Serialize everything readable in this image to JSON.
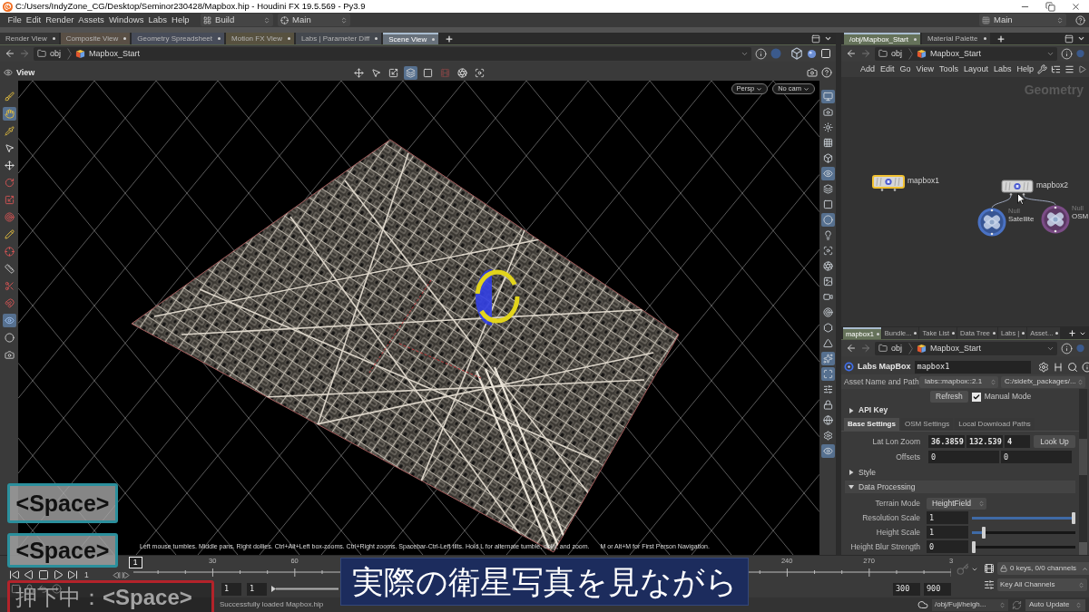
{
  "window": {
    "title": "C:/Users/IndyZone_CG/Desktop/Seminor230428/Mapbox.hip - Houdini FX 19.5.569 - Py3.9"
  },
  "menu_bar": {
    "items": [
      "File",
      "Edit",
      "Render",
      "Assets",
      "Windows",
      "Labs",
      "Help"
    ],
    "desktop": "Build",
    "layout": "Main",
    "right_layout": "Main"
  },
  "viewer": {
    "tabs": [
      {
        "label": "Render View",
        "selected": false,
        "color": "#353535"
      },
      {
        "label": "Composite View",
        "selected": false,
        "color": "#594f45"
      },
      {
        "label": "Geometry Spreadsheet",
        "selected": false,
        "color": "#474c59"
      },
      {
        "label": "Motion FX View",
        "selected": false,
        "color": "#57513f"
      },
      {
        "label": "Labs | Parameter Diff",
        "selected": false,
        "color": "#44484e"
      },
      {
        "label": "Scene View",
        "selected": true,
        "color": "#68717b"
      }
    ],
    "path": [
      "obj",
      "Mapbox_Start"
    ],
    "toolbar_label": "View",
    "view_tools": [
      {
        "selected": false
      },
      {
        "selected": false
      },
      {
        "selected": false
      },
      {
        "selected": true
      },
      {
        "selected": false
      },
      {
        "selected": false
      },
      {
        "selected": false
      },
      {
        "selected": false
      }
    ],
    "left_tools": [
      {
        "selected": false
      },
      {
        "selected": true
      },
      {
        "selected": false
      },
      {
        "selected": false
      },
      {
        "selected": false
      },
      {
        "selected": false
      },
      {
        "selected": false
      },
      {
        "selected": false
      },
      {
        "selected": false
      },
      {
        "selected": false
      },
      {
        "selected": false
      },
      {
        "selected": false
      },
      {
        "selected": false
      },
      {
        "selected": true
      },
      {
        "selected": false
      },
      {
        "selected": false
      }
    ],
    "right_tools": [
      {
        "selected": true
      },
      {
        "selected": false
      },
      {
        "selected": false
      },
      {
        "selected": false
      },
      {
        "selected": false
      },
      {
        "selected": true
      },
      {
        "selected": false
      },
      {
        "selected": false
      },
      {
        "selected": true
      },
      {
        "selected": false
      },
      {
        "selected": false
      },
      {
        "selected": false
      },
      {
        "selected": false
      },
      {
        "selected": false
      },
      {
        "selected": false
      },
      {
        "selected": false
      },
      {
        "selected": false
      },
      {
        "selected": true
      },
      {
        "selected": true
      },
      {
        "selected": false
      },
      {
        "selected": false
      },
      {
        "selected": false
      },
      {
        "selected": false
      },
      {
        "selected": true
      }
    ],
    "camera_menus": [
      "Persp",
      "No cam"
    ],
    "hint": "Left mouse tumbles. Middle pans. Right dollies. Ctrl+Alt+Left box-zooms. Ctrl+Right zooms. Spacebar-Ctrl-Left tilts. Hold L for alternate tumble, dolly, and zoom.",
    "hint_extra": "M or Alt+M for First Person Navigation."
  },
  "network": {
    "tabs": [
      {
        "label": "/obj/Mapbox_Start",
        "selected": true
      },
      {
        "label": "Material Palette",
        "selected": false
      }
    ],
    "path": [
      "obj",
      "Mapbox_Start"
    ],
    "menu": [
      "Add",
      "Edit",
      "Go",
      "View",
      "Tools",
      "Layout",
      "Labs",
      "Help"
    ],
    "context": "Geometry",
    "nodes": [
      {
        "name": "mapbox1",
        "kind": "hda",
        "selected": true
      },
      {
        "name": "mapbox2",
        "kind": "hda",
        "selected": false
      },
      {
        "name": "Satellite",
        "kind": "null",
        "type_label": "Null",
        "selected": false,
        "color": "#4a72c4"
      },
      {
        "name": "OSM",
        "kind": "null",
        "type_label": "Null",
        "selected": false,
        "color": "#7b4c86"
      }
    ]
  },
  "parameters": {
    "tabs": [
      {
        "label": "mapbox1",
        "selected": true
      },
      {
        "label": "Bundle...",
        "selected": false
      },
      {
        "label": "Take List",
        "selected": false
      },
      {
        "label": "Data Tree",
        "selected": false
      },
      {
        "label": "Labs |",
        "selected": false
      },
      {
        "label": "Asset...",
        "selected": false
      }
    ],
    "path": [
      "obj",
      "Mapbox_Start"
    ],
    "node_type": "Labs MapBox",
    "node_name": "mapbox1",
    "asset_label": "Asset Name and Path",
    "asset_name": "labs::mapbox::2.1",
    "asset_path": "C:/sidefx_packages/...",
    "refresh": "Refresh",
    "manual_mode": {
      "label": "Manual Mode",
      "checked": true
    },
    "api_key": {
      "label": "API Key",
      "expanded": false
    },
    "settings_tabs": [
      {
        "label": "Base Settings",
        "selected": true
      },
      {
        "label": "OSM Settings",
        "selected": false
      },
      {
        "label": "Local Download Paths",
        "selected": false
      }
    ],
    "lat_lon_zoom": {
      "label": "Lat Lon Zoom",
      "values": [
        "36.3859",
        "132.539",
        "4"
      ],
      "button": "Look Up"
    },
    "offsets": {
      "label": "Offsets",
      "values": [
        "0",
        "0"
      ]
    },
    "folders": [
      {
        "label": "Style",
        "expanded": false
      },
      {
        "label": "Data Processing",
        "expanded": true,
        "params": [
          {
            "kind": "menu",
            "label": "Terrain Mode",
            "value": "HeightField"
          },
          {
            "kind": "slider",
            "label": "Resolution Scale",
            "value": "1",
            "level": 1
          },
          {
            "kind": "slider",
            "label": "Height Scale",
            "value": "1",
            "level": 0.1
          },
          {
            "kind": "slider",
            "label": "Height Blur Strength",
            "value": "0",
            "level": 0
          }
        ]
      }
    ]
  },
  "timeline": {
    "current_frame": "1",
    "frame_field": "1",
    "tick_labels": [
      "30",
      "60",
      "240",
      "270",
      "3"
    ],
    "range_start": "1",
    "range_end": "1",
    "end_frame": "300",
    "global_end": "900",
    "keys_status": "0 keys, 0/0 channels",
    "key_all": "Key All Channels"
  },
  "status_bar": {
    "message": "Successfully loaded Mapbox.hip",
    "node_path": "/obj/Fuji/heigh...",
    "update_mode": "Auto Update"
  },
  "overlays": {
    "key_badges": [
      "<Space>",
      "<Space>"
    ],
    "held_key": "押下中：**<Space>**",
    "subtitle": "実際の衛星写真を見ながら"
  }
}
